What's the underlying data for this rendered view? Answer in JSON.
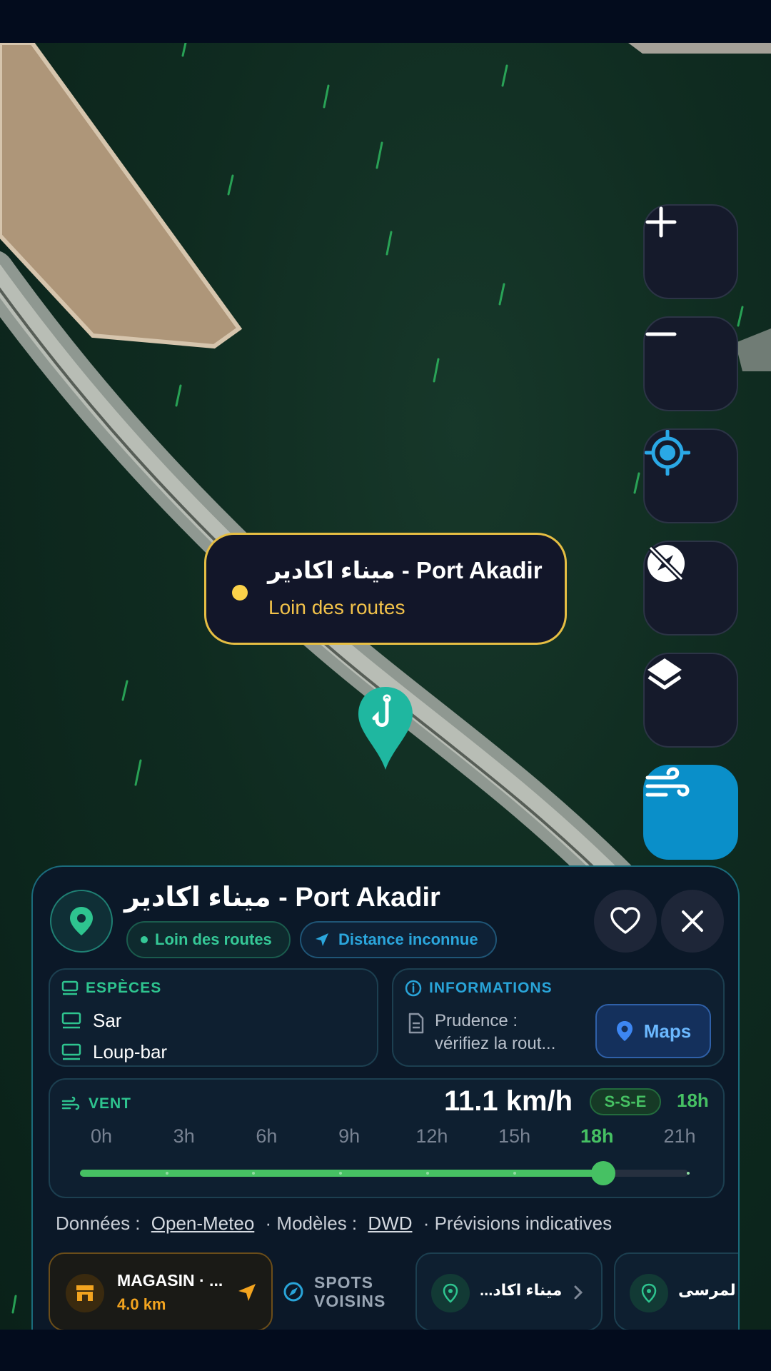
{
  "map": {
    "marker_icon": "fishing-hook-icon"
  },
  "controls": [
    {
      "name": "zoom-in-button",
      "icon": "plus-icon"
    },
    {
      "name": "zoom-out-button",
      "icon": "minus-icon"
    },
    {
      "name": "my-location-button",
      "icon": "crosshair-icon"
    },
    {
      "name": "compass-off-button",
      "icon": "compass-off-icon"
    },
    {
      "name": "layers-button",
      "icon": "layers-icon"
    },
    {
      "name": "wind-toggle-button",
      "icon": "wind-icon"
    }
  ],
  "tooltip": {
    "title": "ميناء اكادير - Port Akadir",
    "subtitle": "Loin des routes"
  },
  "panel": {
    "title": "ميناء اكادير - Port Akadir",
    "chip_access": "Loin des routes",
    "chip_distance": "Distance inconnue",
    "species": {
      "heading": "ESPÈCES",
      "items": [
        "Sar",
        "Loup-bar"
      ]
    },
    "info": {
      "heading": "INFORMATIONS",
      "text_line1": "Prudence :",
      "text_line2": "vérifiez la rout...",
      "maps_label": "Maps"
    },
    "wind": {
      "heading": "VENT",
      "speed": "11.1 km/h",
      "direction": "S-S-E",
      "selected_hour": "18h",
      "hours": [
        "0h",
        "3h",
        "6h",
        "9h",
        "12h",
        "15h",
        "18h",
        "21h"
      ],
      "selected_index": 6,
      "progress": 0.86
    },
    "sources": {
      "data_label": "Données :",
      "data_link": "Open-Meteo",
      "models_label": "· Modèles :",
      "models_link": "DWD",
      "note": "· Prévisions indicatives"
    },
    "shop": {
      "name": "MAGASIN · ...",
      "distance": "4.0 km"
    },
    "neighbors_label_1": "SPOTS",
    "neighbors_label_2": "VOISINS",
    "neighbor_spots": [
      "...ميناء اكاد",
      "لمرسى"
    ]
  },
  "colors": {
    "accent_green": "#46c163",
    "accent_teal": "#2ec48f",
    "accent_blue": "#0a8fc9",
    "tooltip_border": "#e6be43",
    "shop_orange": "#f3a41f"
  }
}
